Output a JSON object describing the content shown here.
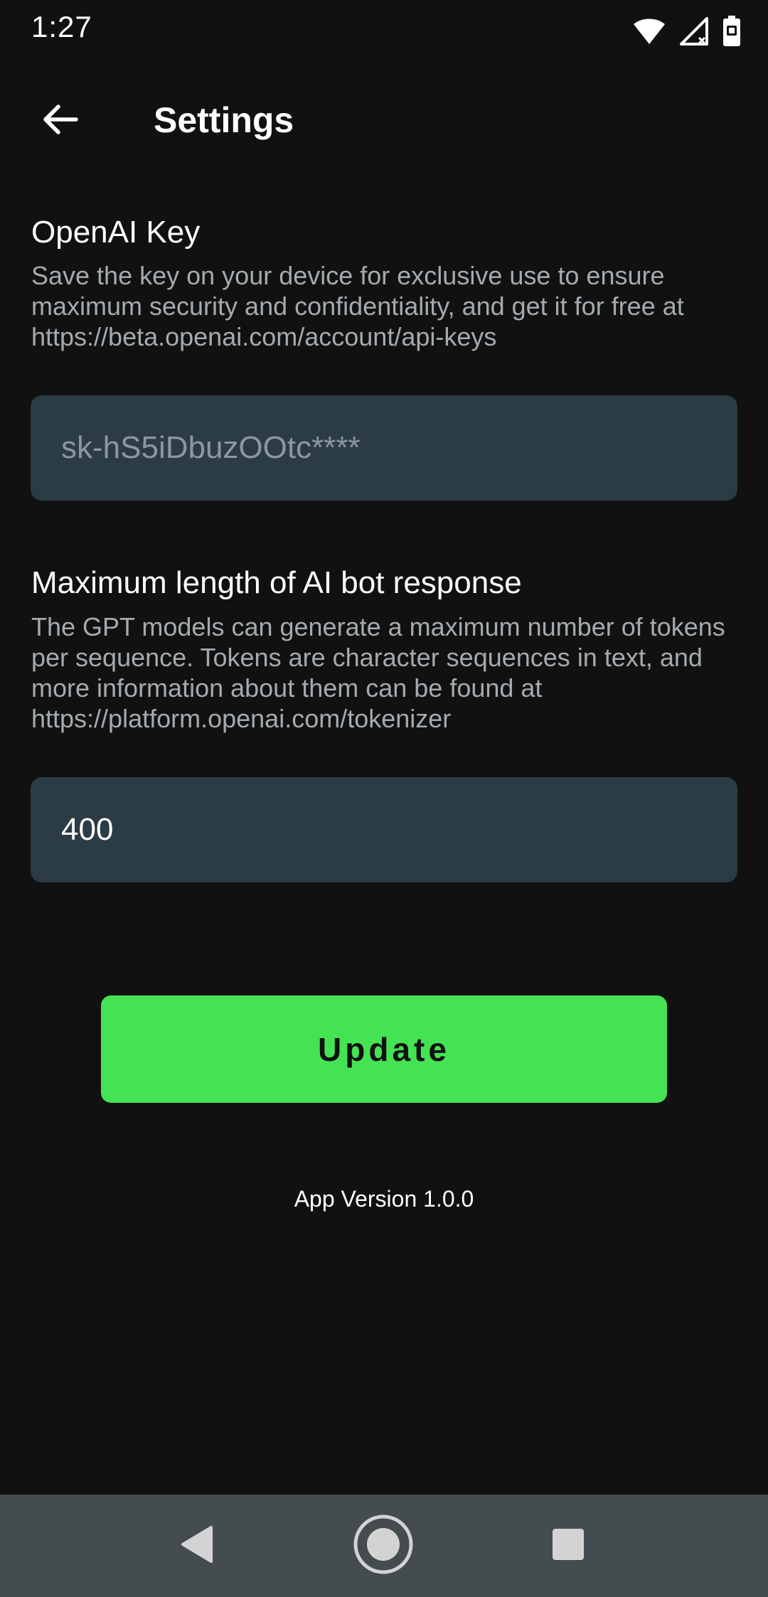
{
  "status_bar": {
    "time": "1:27",
    "icons": [
      "wifi-icon",
      "signal-icon",
      "battery-icon"
    ]
  },
  "app_bar": {
    "back_icon": "arrow-left-icon",
    "title": "Settings"
  },
  "openai_key": {
    "title": "OpenAI Key",
    "description": "Save the key on your device for exclusive use to ensure maximum security and confidentiality, and get it for free at https://beta.openai.com/account/api-keys",
    "placeholder": "sk-hS5iDbuzOOtc****",
    "value": ""
  },
  "max_length": {
    "title": "Maximum length of AI bot response",
    "description": "The GPT models can generate a maximum number of tokens per sequence. Tokens are character sequences in text, and more information about them can be found at https://platform.openai.com/tokenizer",
    "value": "400"
  },
  "update_button": {
    "label": "Update"
  },
  "footer": {
    "app_version": "App Version 1.0.0"
  },
  "nav_bar": {
    "back": "nav-back-icon",
    "home": "nav-home-icon",
    "recents": "nav-recents-icon"
  },
  "colors": {
    "background": "#111111",
    "input_background": "#2c3c46",
    "accent": "#44e354",
    "description_text": "#a4abb0",
    "nav_background": "#444c50"
  }
}
